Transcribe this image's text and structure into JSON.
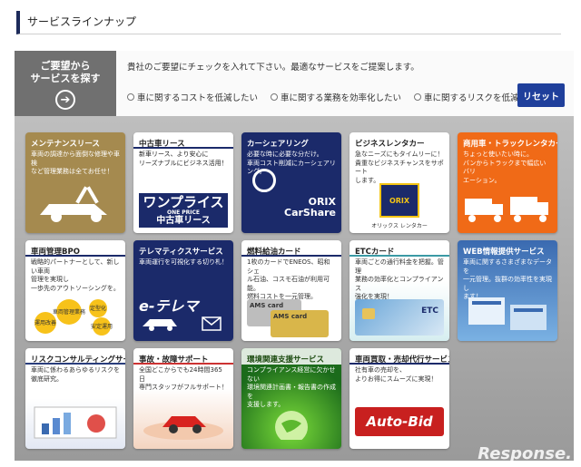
{
  "header": {
    "title": "サービスラインナップ"
  },
  "finder": {
    "line1": "ご要望から",
    "line2": "サービスを探す",
    "arrow": "➔"
  },
  "filter": {
    "lead": "貴社のご要望にチェックを入れて下さい。最適なサービスをご提案します。",
    "options": [
      "車に関するコストを低減したい",
      "車に関する業務を効率化したい",
      "車に関するリスクを低減したい"
    ],
    "reset_label": "リセット"
  },
  "cards": [
    {
      "title": "メンテナンスリース",
      "desc": "車両の調達から面倒な修理や車検\nなど管理業務は全てお任せ！"
    },
    {
      "title": "中古車リース",
      "desc": "新車リース、より安心に\nリーズナブルにビジネス活用！",
      "logo_big": "ワンプライス",
      "logo_small": "ONE PRICE",
      "logo_mid": "中古車リース"
    },
    {
      "title": "カーシェアリング",
      "desc": "必要な時に必要な分だけ。\n車両コスト削減にカーシェアリング。",
      "logo_top": "ORIX",
      "logo_bottom": "CarShare"
    },
    {
      "title": "ビジネスレンタカー",
      "desc": "急なニーズにもタイムリーに！\n貴重なビジネスチャンスをサポート\nします。",
      "logo": "ORIX",
      "logo_sub": "Rent-A-Car",
      "logo_caption": "オリックス レンタカー"
    },
    {
      "title": "商用車・トラックレンタカー",
      "desc": "ちょっと使いたい時に。\nバンからトラックまで幅広いバリ\nエーション。"
    },
    {
      "title": "車両管理BPO",
      "desc": "戦略的パートナーとして、新しい車両\n管理を実現し\n一歩先のアウトソーシングを。",
      "bubbles": [
        "運用改善",
        "車両管理業務",
        "定型化",
        "安定運用"
      ]
    },
    {
      "title": "テレマティクスサービス",
      "desc": "車両運行を可視化する切り札！",
      "logo": "e-テレマ"
    },
    {
      "title": "燃料給油カード",
      "desc": "1枚のカードでENEOS、昭和シェ\nル石油、コスモ石油が利用可能。\n燃料コストを一元管理。",
      "card1": "AMS card",
      "card2": "AMS card"
    },
    {
      "title": "ETCカード",
      "desc": "車両ごとの通行料金を把握。管理\n業務の効率化とコンプライアンス\n強化を実現！",
      "card_label": "ETC"
    },
    {
      "title": "WEB情報提供サービス",
      "desc": "車両に関するさまざまなデータを\n一元管理。抜群の効率性を実現し\nます！"
    },
    {
      "title": "リスクコンサルティングサービス",
      "desc": "車両に係わるあらゆるリスクを\n徹底研究。"
    },
    {
      "title": "事故・故障サポート",
      "desc": "全国どこからでも24時間365日\n専門スタッフがフルサポート！"
    },
    {
      "title": "環境関連支援サービス",
      "desc": "コンプライアンス経営に欠かせない\n環境関連計画書・報告書の作成を\n支援します。"
    },
    {
      "title": "車両買取・売却代行サービス",
      "desc": "社有車の売却を、\nよりお得にスムーズに実現！",
      "logo": "Auto-Bid"
    }
  ],
  "watermark": "Response."
}
